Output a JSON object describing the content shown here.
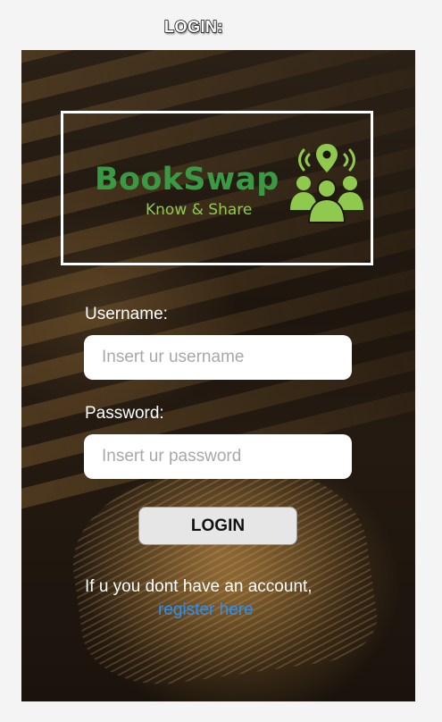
{
  "page_label": "LOGIN:",
  "logo": {
    "title": "BookSwap",
    "tagline": "Know & Share",
    "icon": "people-location-pin-icon"
  },
  "form": {
    "username_label": "Username:",
    "username_placeholder": "Insert ur username",
    "username_value": "",
    "password_label": "Password:",
    "password_placeholder": "Insert ur password",
    "password_value": "",
    "submit_label": "LOGIN"
  },
  "register": {
    "prompt": "If u you dont have an account,",
    "link_text": "register here"
  },
  "colors": {
    "brand_green": "#3a9a44",
    "tagline_green": "#8fca4f",
    "link_blue": "#2f8ff0"
  }
}
